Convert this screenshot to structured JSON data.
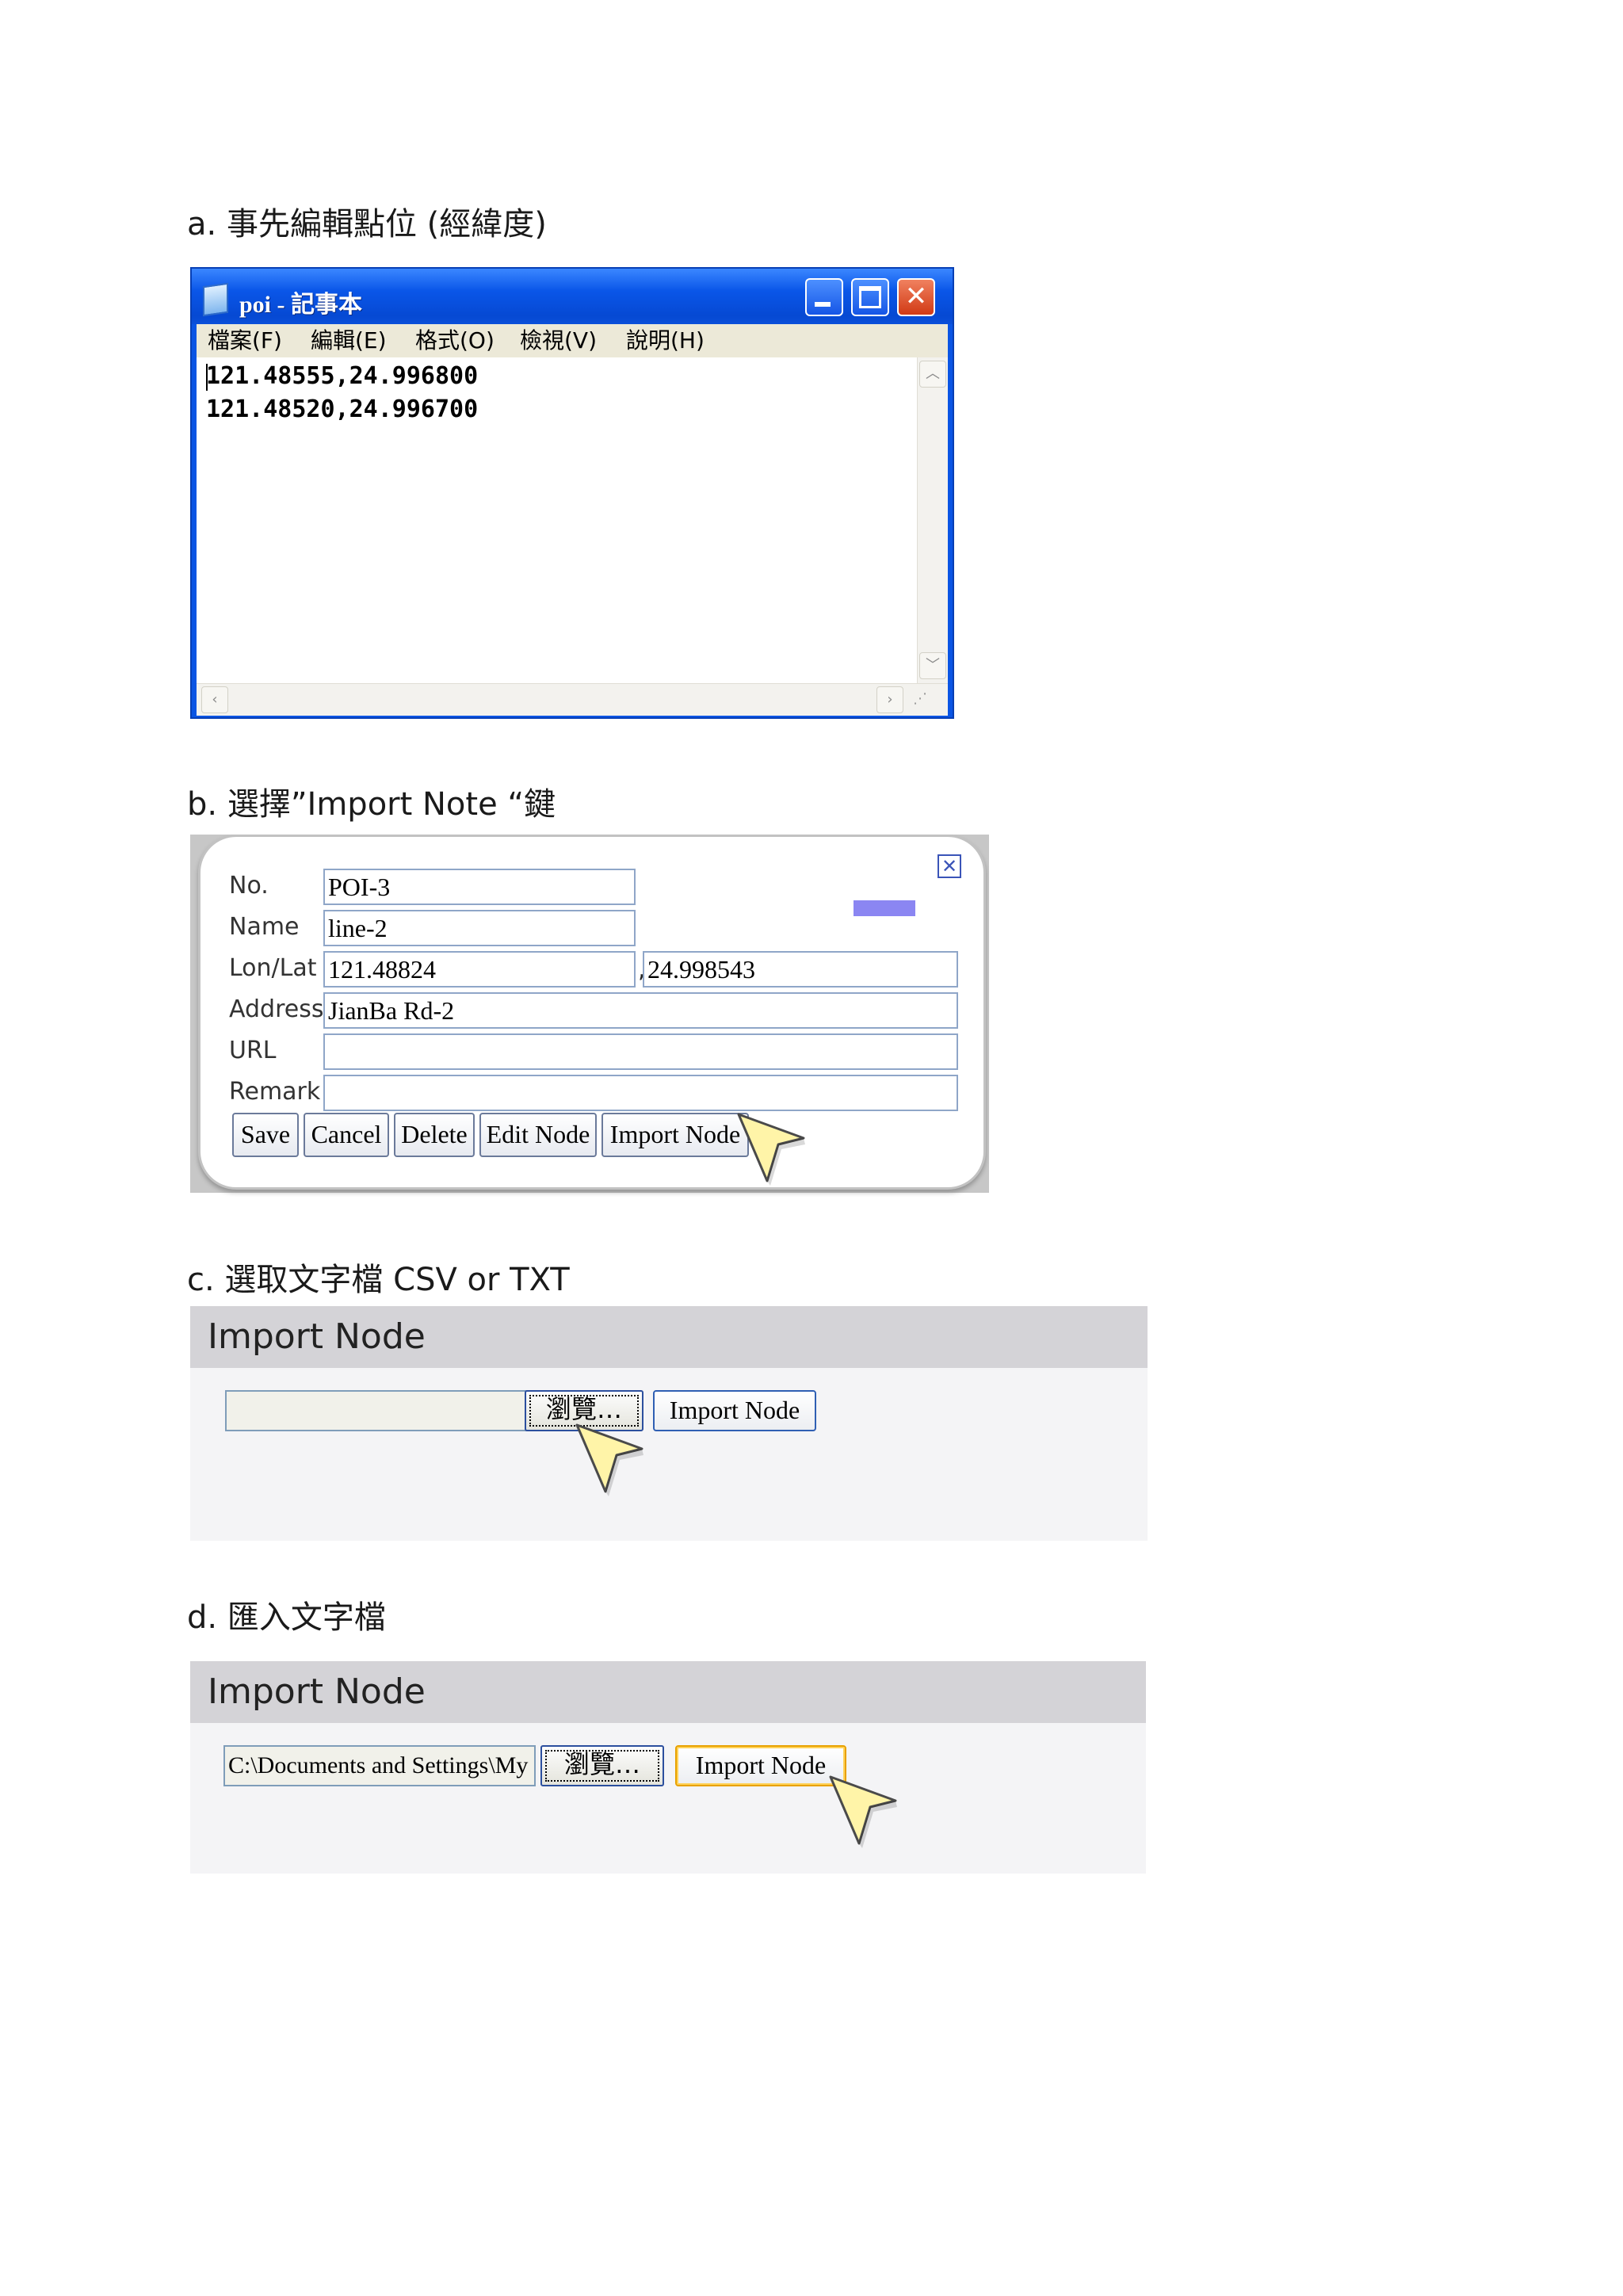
{
  "steps": {
    "a": "a.  事先編輯點位  (經緯度)",
    "b": "b.  選擇”Import Note  “鍵",
    "c": "c.  選取文字檔 CSV or TXT",
    "d": "d.  匯入文字檔"
  },
  "notepad": {
    "title": "poi - 記事本",
    "menu": [
      "檔案(F)",
      "編輯(E)",
      "格式(O)",
      "檢視(V)",
      "說明(H)"
    ],
    "lines": [
      "121.48555,24.996800",
      "121.48520,24.996700"
    ]
  },
  "node_form": {
    "labels": {
      "no": "No.",
      "name": "Name",
      "lonlat": "Lon/Lat",
      "address": "Address",
      "url": "URL",
      "remark": "Remark"
    },
    "values": {
      "no": "POI-3",
      "name": "line-2",
      "lon": "121.48824",
      "lat": "24.998543",
      "address": "JianBa Rd-2",
      "url": "",
      "remark": ""
    },
    "separator": ",",
    "buttons": [
      "Save",
      "Cancel",
      "Delete",
      "Edit Node",
      "Import Node"
    ]
  },
  "import_c": {
    "title": "Import Node",
    "file_value": "",
    "browse_label": "瀏覽…",
    "import_label": "Import Node"
  },
  "import_d": {
    "title": "Import Node",
    "file_value": "C:\\Documents and Settings\\My",
    "browse_label": "瀏覽…",
    "import_label": "Import Node"
  },
  "colors": {
    "xp_blue": "#0a55e4",
    "popup_accent": "#8b86f2",
    "cursor_yellow": "#fff4a8"
  }
}
